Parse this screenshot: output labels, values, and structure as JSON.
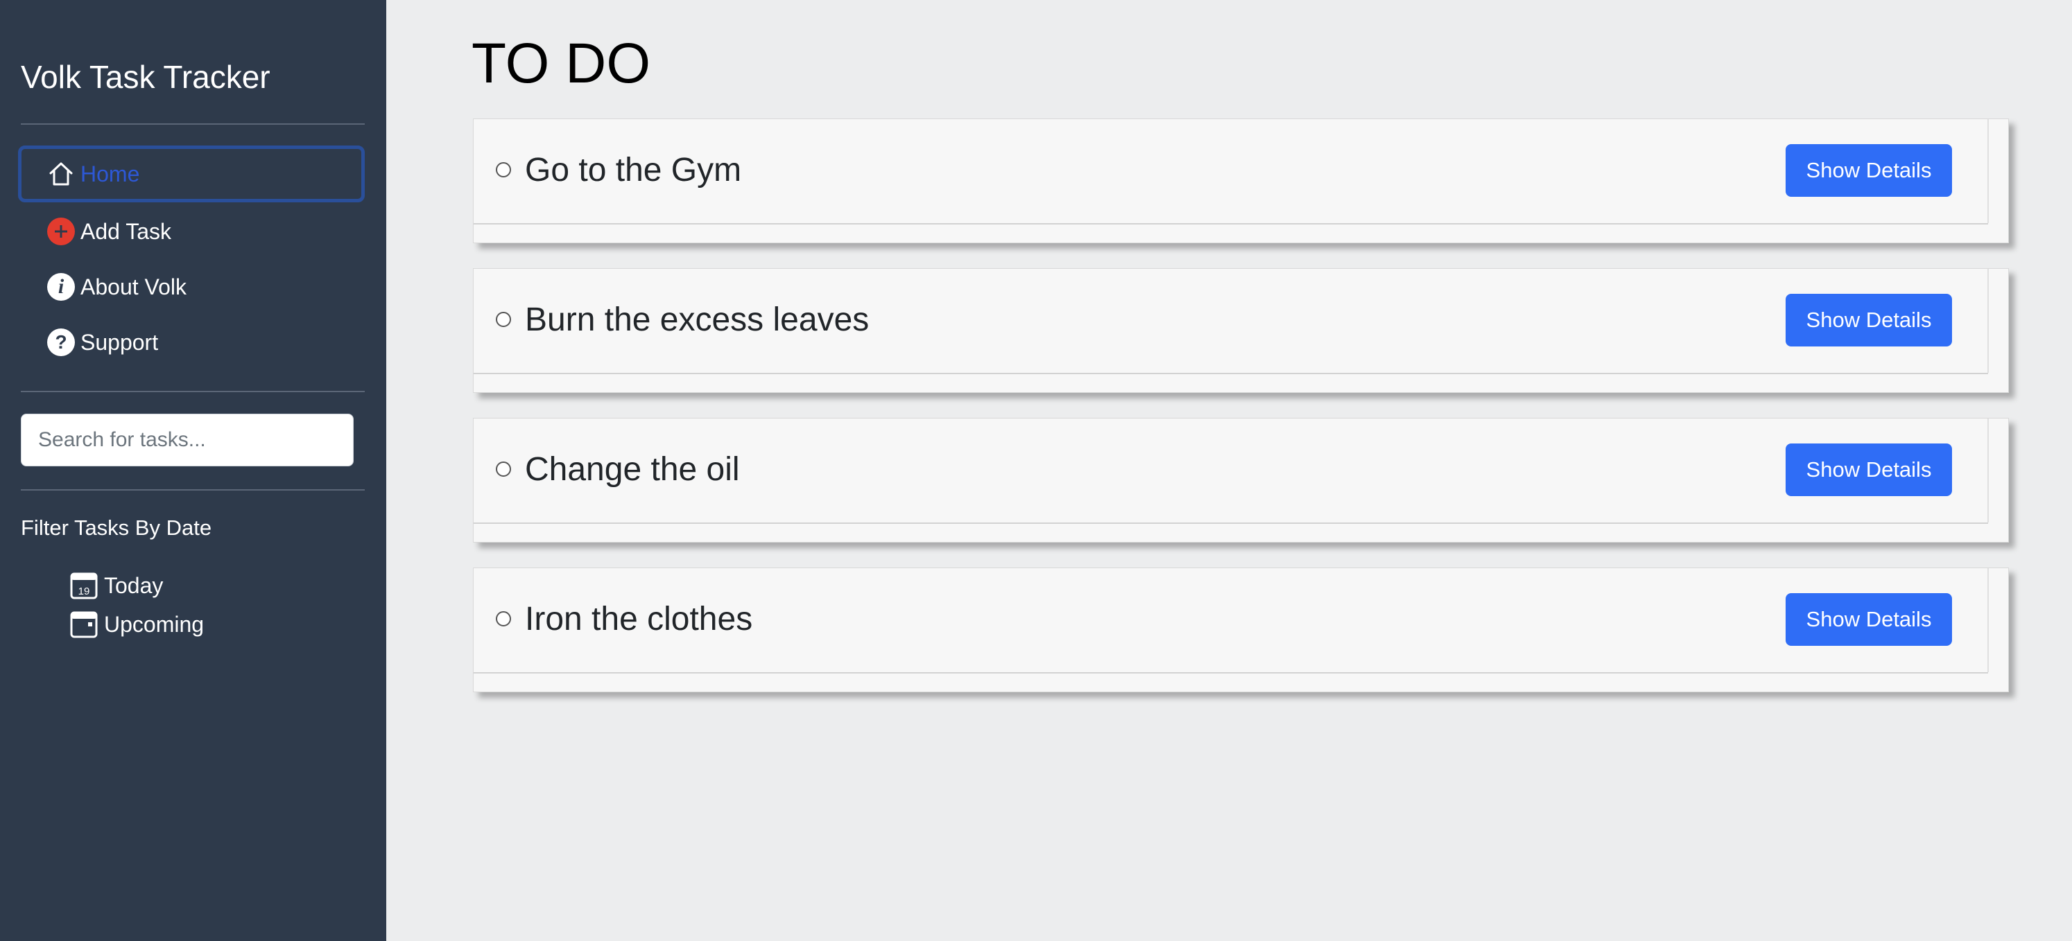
{
  "app": {
    "title": "Volk Task Tracker"
  },
  "sidebar": {
    "nav": [
      {
        "label": "Home",
        "icon": "home-icon",
        "active": true
      },
      {
        "label": "Add Task",
        "icon": "add-circle-icon",
        "active": false
      },
      {
        "label": "About Volk",
        "icon": "info-icon",
        "active": false
      },
      {
        "label": "Support",
        "icon": "question-icon",
        "active": false
      }
    ],
    "search": {
      "placeholder": "Search for tasks...",
      "value": ""
    },
    "filter": {
      "heading": "Filter Tasks By Date",
      "items": [
        {
          "label": "Today",
          "icon": "calendar-day-icon",
          "day": "19"
        },
        {
          "label": "Upcoming",
          "icon": "calendar-icon"
        }
      ]
    }
  },
  "main": {
    "title": "TO DO",
    "tasks": [
      {
        "title": "Go to the Gym",
        "button": "Show Details",
        "completed": false
      },
      {
        "title": "Burn the excess leaves",
        "button": "Show Details",
        "completed": false
      },
      {
        "title": "Change the oil",
        "button": "Show Details",
        "completed": false
      },
      {
        "title": "Iron the clothes",
        "button": "Show Details",
        "completed": false
      }
    ]
  },
  "colors": {
    "sidebar_bg": "#2e3a4b",
    "page_bg": "#ecedee",
    "accent": "#2f6df6",
    "active_nav_text": "#2d58d6",
    "add_icon": "#e33b2e"
  }
}
